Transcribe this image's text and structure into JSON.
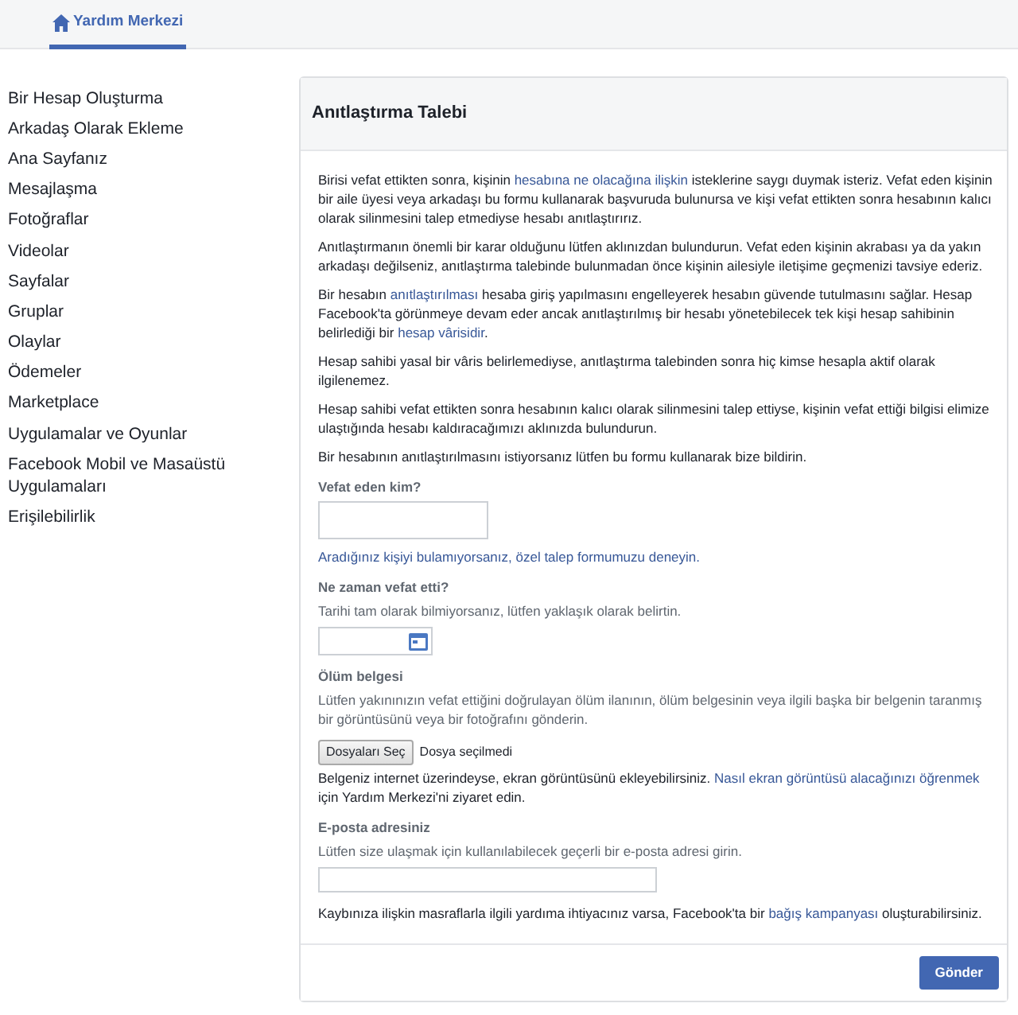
{
  "top_nav": {
    "tabs": [
      {
        "label": "Yardım Merkezi",
        "selected": true
      }
    ]
  },
  "sidebar": {
    "items": [
      {
        "label": "Bir Hesap Oluşturma"
      },
      {
        "label": "Arkadaş Olarak Ekleme"
      },
      {
        "label": "Ana Sayfanız"
      },
      {
        "label": "Mesajlaşma"
      },
      {
        "label": "Fotoğraflar"
      },
      {
        "label": "Videolar"
      },
      {
        "label": "Sayfalar"
      },
      {
        "label": "Gruplar"
      },
      {
        "label": "Olaylar"
      },
      {
        "label": "Ödemeler"
      },
      {
        "label": "Marketplace"
      },
      {
        "label": "Uygulamalar ve Oyunlar"
      },
      {
        "label": "Facebook Mobil ve Masaüstü Uygulamaları"
      },
      {
        "label": "Erişilebilirlik"
      }
    ]
  },
  "form": {
    "title": "Anıtlaştırma Talebi",
    "intro": [
      {
        "parts": [
          {
            "kind": "text",
            "text": "Birisi vefat ettikten sonra, kişinin "
          },
          {
            "kind": "link",
            "text": "hesabına ne olacağına ilişkin"
          },
          {
            "kind": "text",
            "text": " isteklerine saygı duymak isteriz. Vefat eden kişinin bir aile üyesi veya arkadaşı bu formu kullanarak başvuruda bulunursa ve kişi vefat ettikten sonra hesabının kalıcı olarak silinmesini talep etmediyse hesabı anıtlaştırırız."
          }
        ]
      },
      {
        "parts": [
          {
            "kind": "text",
            "text": "Anıtlaştırmanın önemli bir karar olduğunu lütfen aklınızdan bulundurun. Vefat eden kişinin akrabası ya da yakın arkadaşı değilseniz, anıtlaştırma talebinde bulunmadan önce kişinin ailesiyle iletişime geçmenizi tavsiye ederiz."
          }
        ]
      },
      {
        "parts": [
          {
            "kind": "text",
            "text": "Bir hesabın "
          },
          {
            "kind": "link",
            "text": "anıtlaştırılması"
          },
          {
            "kind": "text",
            "text": " hesaba giriş yapılmasını engelleyerek hesabın güvende tutulmasını sağlar. Hesap Facebook'ta görünmeye devam eder ancak anıtlaştırılmış bir hesabı yönetebilecek tek kişi hesap sahibinin belirlediği bir "
          },
          {
            "kind": "link",
            "text": "hesap vârisidir"
          },
          {
            "kind": "text",
            "text": "."
          }
        ]
      },
      {
        "parts": [
          {
            "kind": "text",
            "text": "Hesap sahibi yasal bir vâris belirlemediyse, anıtlaştırma talebinden sonra hiç kimse hesapla aktif olarak ilgilenemez."
          }
        ]
      },
      {
        "parts": [
          {
            "kind": "text",
            "text": "Hesap sahibi vefat ettikten sonra hesabının kalıcı olarak silinmesini talep ettiyse, kişinin vefat ettiği bilgisi elimize ulaştığında hesabı kaldıracağımızı aklınızda bulundurun."
          }
        ]
      },
      {
        "parts": [
          {
            "kind": "text",
            "text": "Bir hesabının anıtlaştırılmasını istiyorsanız lütfen bu formu kullanarak bize bildirin."
          }
        ]
      }
    ],
    "fields": [
      {
        "kind": "text",
        "label": "Vefat eden kim?",
        "help_link": "Aradığınız kişiyi bulamıyorsanız, özel talep formumuzu deneyin."
      },
      {
        "kind": "date",
        "label": "Ne zaman vefat etti?",
        "description": "Tarihi tam olarak bilmiyorsanız, lütfen yaklaşık olarak belirtin."
      },
      {
        "kind": "file",
        "label": "Ölüm belgesi",
        "description": "Lütfen yakınınızın vefat ettiğini doğrulayan ölüm ilanının, ölüm belgesinin veya ilgili başka bir belgenin taranmış bir görüntüsünü veya bir fotoğrafını gönderin.",
        "button": "Dosyaları Seç",
        "status": "Dosya seçilmedi",
        "note": [
          {
            "kind": "text",
            "text": "Belgeniz internet üzerindeyse, ekran görüntüsünü ekleyebilirsiniz. "
          },
          {
            "kind": "link",
            "text": "Nasıl ekran görüntüsü alacağınızı öğrenmek"
          },
          {
            "kind": "text",
            "text": " için Yardım Merkezi'ni ziyaret edin."
          }
        ]
      },
      {
        "kind": "email",
        "label": "E-posta adresiniz",
        "description": "Lütfen size ulaşmak için kullanılabilecek geçerli bir e-posta adresi girin."
      }
    ],
    "closing": [
      {
        "kind": "text",
        "text": "Kaybınıza ilişkin masraflarla ilgili yardıma ihtiyacınız varsa, Facebook'ta bir "
      },
      {
        "kind": "link",
        "text": "bağış kampanyası"
      },
      {
        "kind": "text",
        "text": " oluşturabilirsiniz."
      }
    ],
    "submit": "Gönder"
  }
}
